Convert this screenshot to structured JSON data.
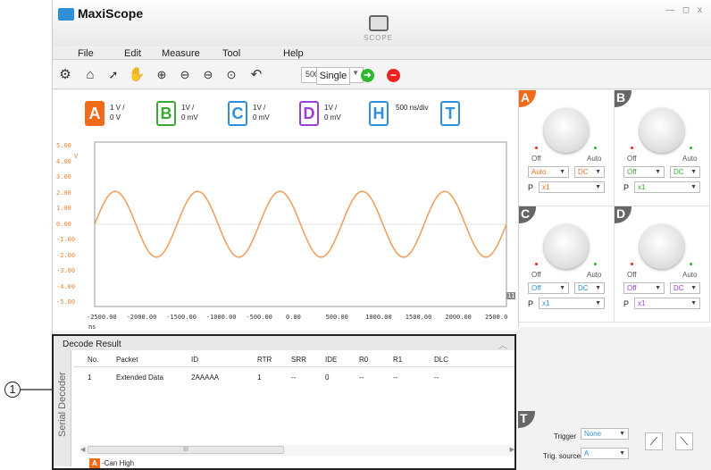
{
  "app": {
    "title": "MaxiScope",
    "scope_label": "SCOPE",
    "window_controls": "— ◻ x"
  },
  "menu": [
    "File",
    "Edit",
    "Measure",
    "Tool",
    "Help"
  ],
  "toolbar": {
    "timebase": "500 ns/div",
    "single": "Single"
  },
  "channels": [
    {
      "letter": "A",
      "line1": "1 V /",
      "line2": "0 V",
      "color": "#f06a1a",
      "filled": true
    },
    {
      "letter": "B",
      "line1": "1V /",
      "line2": "0 mV",
      "color": "#3aa832",
      "filled": false
    },
    {
      "letter": "C",
      "line1": "1V /",
      "line2": "0 mV",
      "color": "#2f8fd8",
      "filled": false
    },
    {
      "letter": "D",
      "line1": "1V /",
      "line2": "0 mV",
      "color": "#9a3fd6",
      "filled": false
    },
    {
      "letter": "H",
      "line1": "500 ns/div",
      "line2": "",
      "color": "#2f8fd8",
      "filled": false
    },
    {
      "letter": "T",
      "line1": "",
      "line2": "",
      "color": "#2f8fd8",
      "filled": false
    }
  ],
  "plot": {
    "y_ticks": [
      "5.00",
      "4.00",
      "3.00",
      "2.00",
      "1.00",
      "0.00",
      "-1.00",
      "-2.00",
      "-3.00",
      "-4.00",
      "-5.00"
    ],
    "y_unit": "V",
    "x_ticks": [
      "-2500.00",
      "-2000.00",
      "-1500.00",
      "-1000.00",
      "-500.00",
      "0.00",
      "500.00",
      "1000.00",
      "1500.00",
      "2000.00",
      "2500.0"
    ],
    "x_unit": "ns",
    "marker_right": "11"
  },
  "chart_data": {
    "type": "line",
    "x_range": [
      -2500,
      2500
    ],
    "y_range": [
      -5,
      5
    ],
    "series": [
      {
        "amplitude": 2,
        "period": 1000,
        "phase_peak_at": -2250,
        "color": "#f0a060"
      }
    ]
  },
  "knobs": [
    {
      "letter": "A",
      "off": "Off",
      "auto": "Auto",
      "mode": "Auto",
      "coupling": "DC",
      "probe_label": "P",
      "probe": "x1",
      "color": "#f06a1a",
      "mode_color": "#f06a1a"
    },
    {
      "letter": "B",
      "off": "Off",
      "auto": "Auto",
      "mode": "Off",
      "coupling": "DC",
      "probe_label": "P",
      "probe": "x1",
      "color": "#666666",
      "mode_color": "#3aa832"
    },
    {
      "letter": "C",
      "off": "Off",
      "auto": "Auto",
      "mode": "Off",
      "coupling": "DC",
      "probe_label": "P",
      "probe": "x1",
      "color": "#666666",
      "mode_color": "#2f8fd8"
    },
    {
      "letter": "D",
      "off": "Off",
      "auto": "Auto",
      "mode": "Off",
      "coupling": "DC",
      "probe_label": "P",
      "probe": "x1",
      "color": "#666666",
      "mode_color": "#9a3fd6"
    }
  ],
  "decode": {
    "title": "Decode Result",
    "side_label": "Serial Decoder",
    "columns": [
      "No.",
      "Packet",
      "ID",
      "RTR",
      "SRR",
      "IDE",
      "R0",
      "R1",
      "DLC"
    ],
    "rows": [
      [
        "1",
        "Extended Data",
        "2AAAAA",
        "1",
        "--",
        "0",
        "--",
        "--",
        "--"
      ]
    ],
    "scroll_thumb": "III",
    "tab_letter": "A",
    "tab_label": "-Can High"
  },
  "trigger": {
    "corner": "T",
    "trigger_label": "Trigger",
    "trigger_value": "None",
    "source_label": "Trig. source",
    "source_value": "A"
  },
  "callout": "1"
}
